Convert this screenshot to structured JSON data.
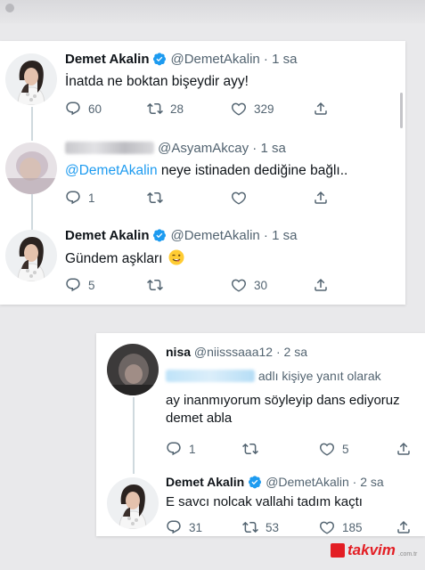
{
  "colors": {
    "accent": "#1d9bf0",
    "text": "#0f1419",
    "muted": "#536471",
    "verified": "#1d9bf0",
    "watermark": "#e31e24"
  },
  "tweets": [
    {
      "name": "Demet Akalin",
      "handle": "@DemetAkalin",
      "sep": "·",
      "time": "1 sa",
      "text": "İnatda ne boktan bişeydir ayy!",
      "replies": "60",
      "retweets": "28",
      "likes": "329"
    },
    {
      "name": "",
      "handle": "@AsyamAkcay",
      "sep": "·",
      "time": "1 sa",
      "mention": "@DemetAkalin",
      "text": " neye istinaden dediğine bağlı..",
      "replies": "1",
      "retweets": "",
      "likes": ""
    },
    {
      "name": "Demet Akalin",
      "handle": "@DemetAkalin",
      "sep": "·",
      "time": "1 sa",
      "text": "Gündem aşkları",
      "replies": "5",
      "retweets": "",
      "likes": "30"
    },
    {
      "name": "nisa",
      "handle": "@niisssaaa12",
      "sep": "·",
      "time": "2 sa",
      "reply_note": "adlı kişiye yanıt olarak",
      "text_line1": "ay inanmıyorum söyleyip dans ediyoruz",
      "text_line2": "demet abla",
      "replies": "1",
      "retweets": "",
      "likes": "5"
    },
    {
      "name": "Demet Akalin",
      "handle": "@DemetAkalin",
      "sep": "·",
      "time": "2 sa",
      "text": "E savcı nolcak vallahi tadım kaçtı",
      "replies": "31",
      "retweets": "53",
      "likes": "185"
    }
  ],
  "icons": {
    "reply": "reply-icon",
    "retweet": "retweet-icon",
    "like": "heart-icon",
    "share": "share-icon",
    "verified": "verified-badge-icon",
    "emoji": "winking-face-emoji"
  },
  "watermark": {
    "brand": "takvim",
    "suffix": ".com.tr"
  }
}
